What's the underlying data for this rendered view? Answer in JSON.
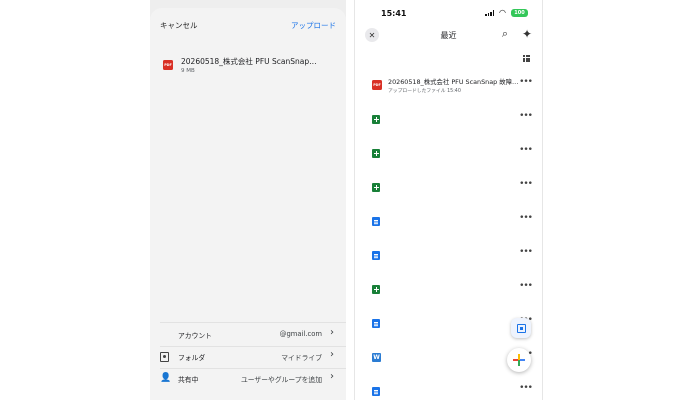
{
  "left_screen": {
    "header": {
      "cancel_label": "キャンセル",
      "upload_label": "アップロード"
    },
    "file": {
      "name": "20260518_株式会社 PFU ScanSnap…",
      "size": "9 MB",
      "icon": "pdf-icon",
      "icon_text": "PDF"
    },
    "options": {
      "account": {
        "label": "アカウント",
        "value": "@gmail.com"
      },
      "folder": {
        "label": "フォルダ",
        "value": "マイドライブ",
        "icon": "folder-icon"
      },
      "sharing": {
        "label": "共有中",
        "value": "ユーザーやグループを追加",
        "icon": "person-add-icon"
      }
    }
  },
  "right_screen": {
    "status_bar": {
      "time": "15:41",
      "battery": "100"
    },
    "title": "最近",
    "files": [
      {
        "type": "pdf",
        "icon_text": "PDF",
        "name": "20260518_株式会社 PFU ScanSnap 故障…",
        "subtitle": "アップロードしたファイル 15:40"
      },
      {
        "type": "sheets"
      },
      {
        "type": "sheets"
      },
      {
        "type": "sheets"
      },
      {
        "type": "docs"
      },
      {
        "type": "docs"
      },
      {
        "type": "sheets"
      },
      {
        "type": "docs"
      },
      {
        "type": "word",
        "icon_text": "W"
      },
      {
        "type": "docs"
      }
    ],
    "more_label": "•••"
  },
  "colors": {
    "accent": "#1a73e8",
    "pdf_red": "#d93025",
    "sheets_green": "#188038",
    "docs_blue": "#1a73e8",
    "battery_green": "#34c759"
  }
}
